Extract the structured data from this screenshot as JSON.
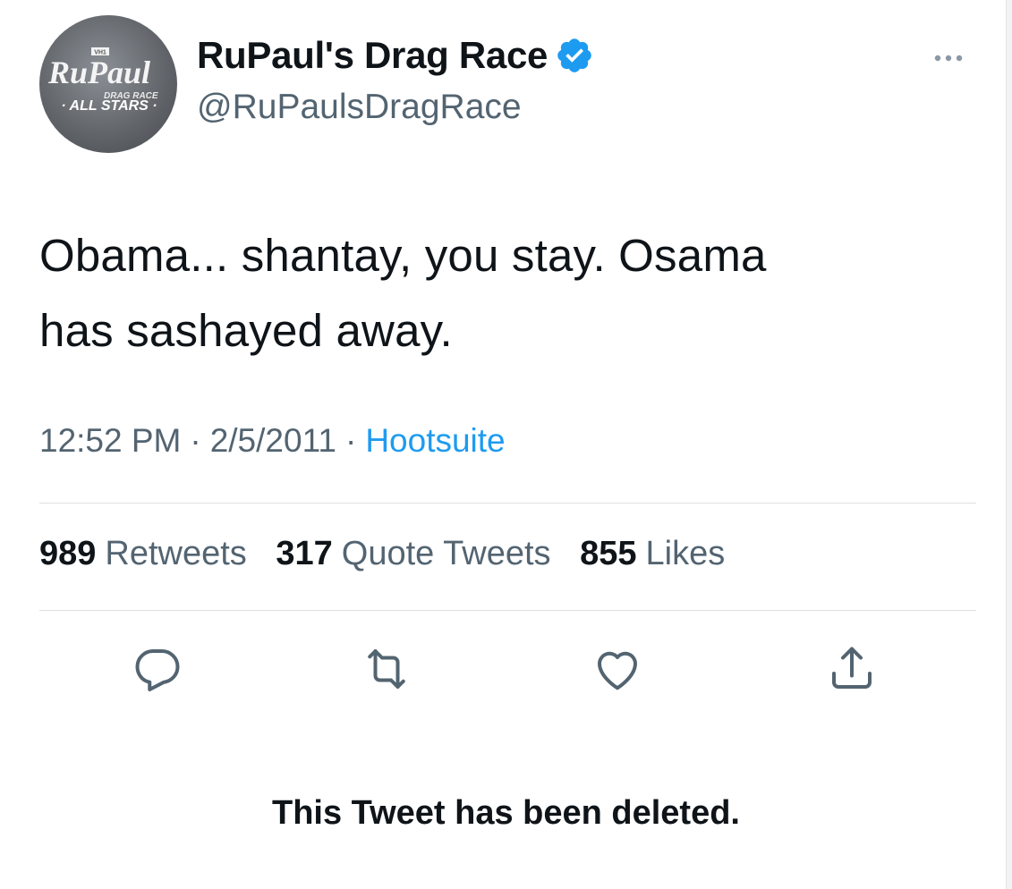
{
  "author": {
    "display_name": "RuPaul's Drag Race",
    "handle": "@RuPaulsDragRace",
    "verified": true,
    "avatar_logo": {
      "network": "VH1",
      "brand": "RuPaul",
      "subtitle": "DRAG RACE",
      "badge": "· ALL STARS ·"
    }
  },
  "tweet": {
    "text_line_1": "Obama... shantay, you stay. Osama",
    "text_line_2": "has sashayed away.",
    "time": "12:52 PM",
    "date": "2/5/2011",
    "separator": "·",
    "source": "Hootsuite"
  },
  "stats": {
    "retweets_count": "989",
    "retweets_label": "Retweets",
    "quotes_count": "317",
    "quotes_label": "Quote Tweets",
    "likes_count": "855",
    "likes_label": "Likes"
  },
  "actions": {
    "icons": [
      "reply-icon",
      "retweet-icon",
      "like-icon",
      "share-icon"
    ]
  },
  "notice": {
    "text": "This Tweet has been deleted."
  },
  "colors": {
    "text_primary": "#0f1419",
    "text_secondary": "#536471",
    "link": "#1d9bf0",
    "verified": "#1d9bf0",
    "divider": "#dcdfe3"
  }
}
